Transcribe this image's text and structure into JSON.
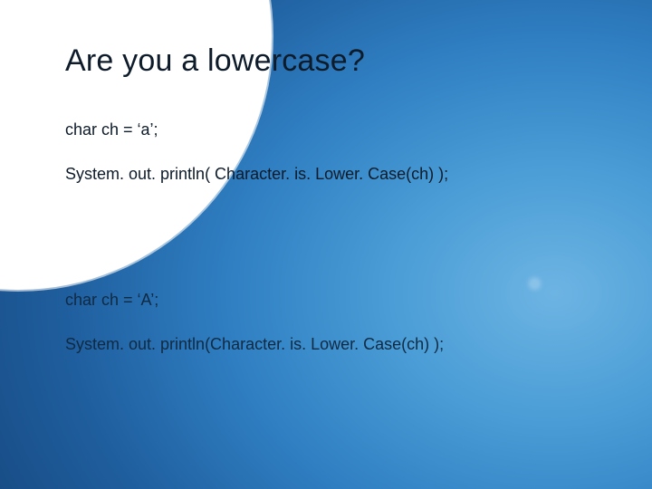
{
  "slide": {
    "title": "Are you a lowercase?",
    "block1": {
      "line1": "char ch = ‘a’;",
      "line2": "System. out. println( Character. is. Lower. Case(ch) );"
    },
    "block2": {
      "line1": "char ch = ‘A’;",
      "line2": "System. out. println(Character. is. Lower. Case(ch) );"
    }
  }
}
